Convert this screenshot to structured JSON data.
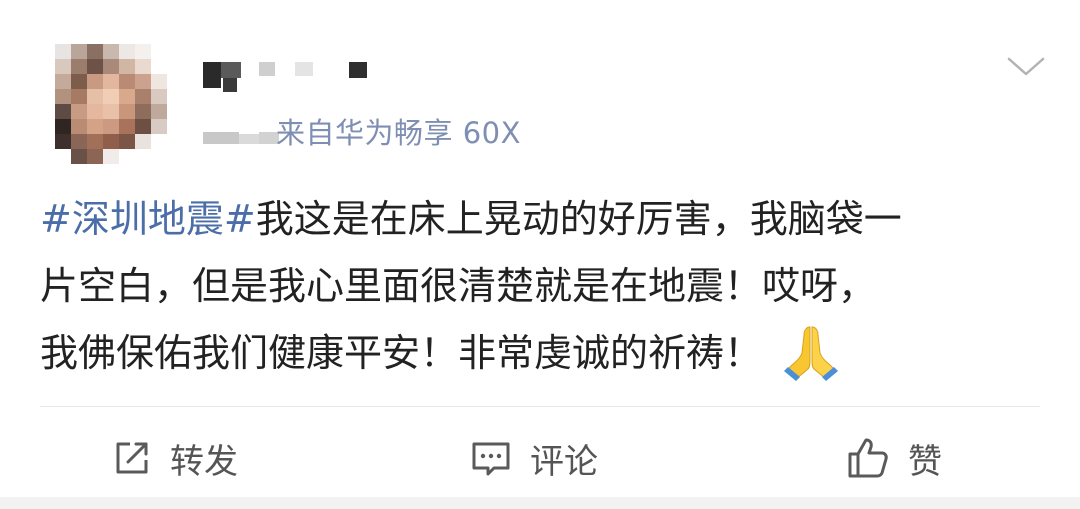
{
  "post": {
    "source_text": "来自华为畅享 60X",
    "body_lines": [
      {
        "hashtag": "#深圳地震#",
        "text": "我这是在床上晃动的好厉害，我脑袋一"
      },
      {
        "hashtag": "",
        "text": "片空白，但是我心里面很清楚就是在地震！哎呀，"
      },
      {
        "hashtag": "",
        "text": "我佛保佑我们健康平安！非常虔诚的祈祷！"
      }
    ],
    "emoji": "folded-hands"
  },
  "actions": {
    "repost_label": "转发",
    "comment_label": "评论",
    "like_label": "赞"
  },
  "colors": {
    "hashtag": "#4b6ea8",
    "source": "#7f8fb3",
    "body_text": "#222222",
    "action_text": "#555555",
    "divider": "#e6e6e6"
  }
}
